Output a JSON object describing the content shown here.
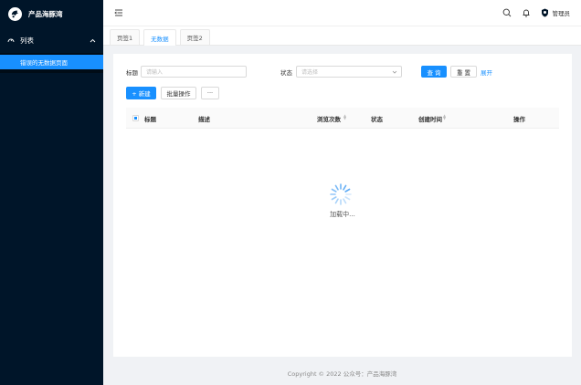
{
  "brand": {
    "title": "产品海豚湾"
  },
  "sidebar": {
    "group_label": "列表",
    "items": [
      {
        "label": "错误的无数据页面",
        "active": true
      }
    ]
  },
  "header": {
    "user_name": "管理员"
  },
  "tabs": [
    {
      "label": "页签1",
      "active": false
    },
    {
      "label": "无数据",
      "active": true
    },
    {
      "label": "页签2",
      "active": false
    }
  ],
  "filters": {
    "title_label": "标题",
    "title_placeholder": "请输入",
    "status_label": "状态",
    "status_placeholder": "请选择",
    "query_button": "查 询",
    "reset_button": "重 置",
    "expand_link": "展开"
  },
  "toolbar": {
    "new_button": "+ 新建",
    "batch_button": "批量操作",
    "more_button": "···"
  },
  "table": {
    "columns": [
      "标题",
      "描述",
      "浏览次数",
      "状态",
      "创建时间",
      "操作"
    ],
    "sortable": [
      false,
      false,
      true,
      false,
      true,
      false
    ]
  },
  "loading": {
    "text": "加载中..."
  },
  "footer": {
    "text": "Copyright © 2022 公众号：产品海豚湾"
  },
  "colors": {
    "primary": "#1890ff",
    "sidebar_bg": "#001529"
  }
}
